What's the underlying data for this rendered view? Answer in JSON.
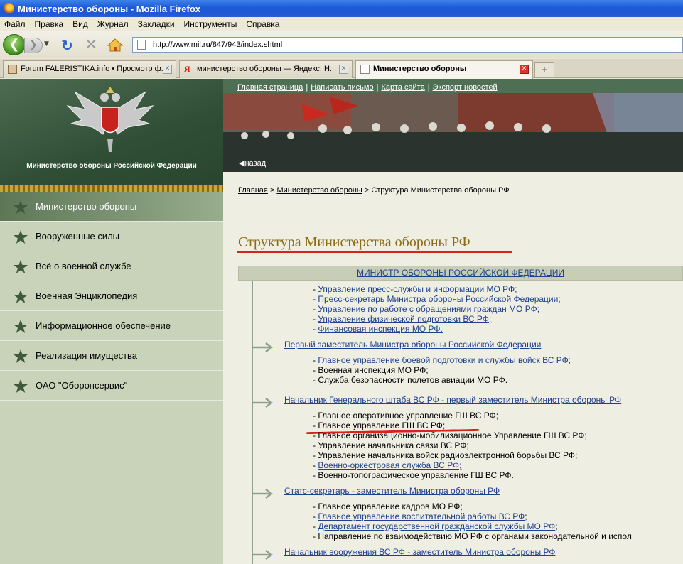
{
  "window": {
    "title": "Министерство обороны - Mozilla Firefox"
  },
  "menu": [
    "Файл",
    "Правка",
    "Вид",
    "Журнал",
    "Закладки",
    "Инструменты",
    "Справка"
  ],
  "toolbar": {
    "url": "http://www.mil.ru/847/943/index.shtml"
  },
  "tabs": [
    {
      "label": "Forum FALERISTIKA.info • Просмотр ф...",
      "active": false
    },
    {
      "label": "министерство обороны — Яндекс: Н...",
      "active": false
    },
    {
      "label": "Министерство обороны",
      "active": true
    }
  ],
  "site": {
    "logo_text": "Министерство обороны Российской Федерации",
    "top_links": [
      "Главная страница",
      "Написать письмо",
      "Карта сайта",
      "Экспорт новостей"
    ],
    "back_label": "назад"
  },
  "sidebar": {
    "items": [
      {
        "label": "Министерство обороны",
        "active": true
      },
      {
        "label": "Вооруженные силы",
        "active": false
      },
      {
        "label": "Всё о военной службе",
        "active": false
      },
      {
        "label": "Военная Энциклопедия",
        "active": false
      },
      {
        "label": "Информационное обеспечение",
        "active": false
      },
      {
        "label": "Реализация имущества",
        "active": false
      },
      {
        "label": "ОАО \"Оборонсервис\"",
        "active": false
      }
    ]
  },
  "content": {
    "breadcrumb": {
      "home": "Главная",
      "sep": ">",
      "ministry": "Министерство обороны",
      "current": "Структура Министерства обороны РФ"
    },
    "heading": "Структура Министерства обороны РФ",
    "minister": "МИНИСТР ОБОРОНЫ РОССИЙСКОЙ ФЕДЕРАЦИИ",
    "minister_items": [
      {
        "text": "Управление пресс-службы и информации МО РФ;",
        "link": true
      },
      {
        "text": "Пресс-секретарь Министра обороны Российской Федерации;",
        "link": true
      },
      {
        "text": "Управление по работе с обращениями граждан МО РФ;",
        "link": true
      },
      {
        "text": "Управление физической подготовки ВС РФ;",
        "link": true
      },
      {
        "text": "Финансовая инспекция МО РФ.",
        "link": true
      }
    ],
    "groups": [
      {
        "head": "Первый заместитель Министра обороны Российской Федерации",
        "items": [
          {
            "text": "Главное управление боевой подготовки и службы войск ВС РФ;",
            "link": true
          },
          {
            "text": "Военная инспекция МО РФ;",
            "link": false
          },
          {
            "text": "Служба безопасности полетов авиации МО РФ.",
            "link": false
          }
        ]
      },
      {
        "head": "Начальник Генерального штаба ВС РФ  - первый заместитель Министра обороны РФ",
        "items": [
          {
            "text": "Главное оперативное управление ГШ ВС РФ;",
            "link": false
          },
          {
            "text": "Главное управление ГШ ВС РФ;",
            "link": false
          },
          {
            "text": "Главное организационно-мобилизационное Управление ГШ ВС РФ;",
            "link": false
          },
          {
            "text": "Управление начальника связи ВС РФ;",
            "link": false
          },
          {
            "text": "Управление начальника войск радиоэлектронной борьбы ВС РФ;",
            "link": false
          },
          {
            "text": "Военно-оркестровая служба  ВС РФ;",
            "link": true
          },
          {
            "text": "Военно-топографическое управление ГШ ВС РФ.",
            "link": false
          }
        ]
      },
      {
        "head": "Статс-секретарь - заместитель Министра обороны РФ",
        "items": [
          {
            "text": "Главное управление кадров МО РФ;",
            "link": false
          },
          {
            "text": "Главное управление воспитательной работы ВС РФ",
            "link": true,
            "suffix": ";"
          },
          {
            "text": "Департамент государственной гражданской службы МО РФ",
            "link": true,
            "suffix": ";"
          },
          {
            "text": "Направление по взаимодействию МО РФ с органами законодательной и испол",
            "link": false
          }
        ]
      },
      {
        "head": "Начальник вооружения ВС РФ - заместитель Министра обороны РФ",
        "items": []
      }
    ]
  }
}
